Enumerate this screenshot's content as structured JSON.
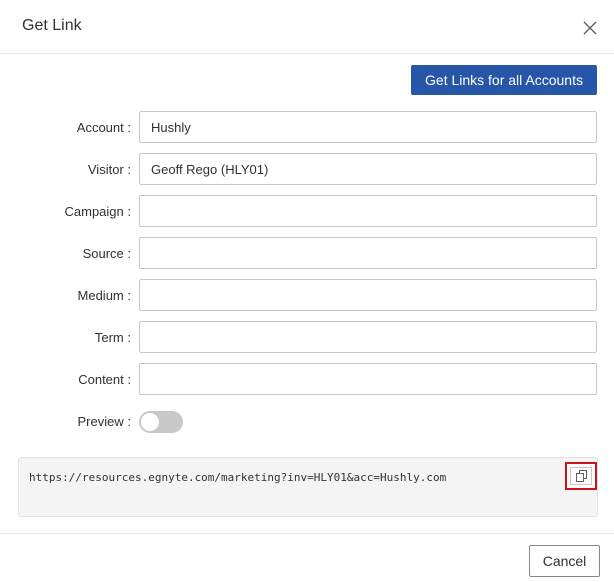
{
  "dialog": {
    "title": "Get Link"
  },
  "toolbar": {
    "get_links_all_label": "Get Links for all Accounts"
  },
  "form": {
    "fields": [
      {
        "label": "Account",
        "value": "Hushly"
      },
      {
        "label": "Visitor",
        "value": "Geoff Rego (HLY01)"
      },
      {
        "label": "Campaign",
        "value": ""
      },
      {
        "label": "Source",
        "value": ""
      },
      {
        "label": "Medium",
        "value": ""
      },
      {
        "label": "Term",
        "value": ""
      },
      {
        "label": "Content",
        "value": ""
      }
    ],
    "preview_label": "Preview",
    "preview_enabled": false
  },
  "link": {
    "url": "https://resources.egnyte.com/marketing?inv=HLY01&acc=Hushly.com"
  },
  "footer": {
    "cancel_label": "Cancel"
  },
  "colors": {
    "primary": "#2756a8",
    "highlight": "#d0121b",
    "toggle_off": "#c8c8c8"
  },
  "icons": {
    "close": "close-icon",
    "copy": "copy-icon"
  }
}
